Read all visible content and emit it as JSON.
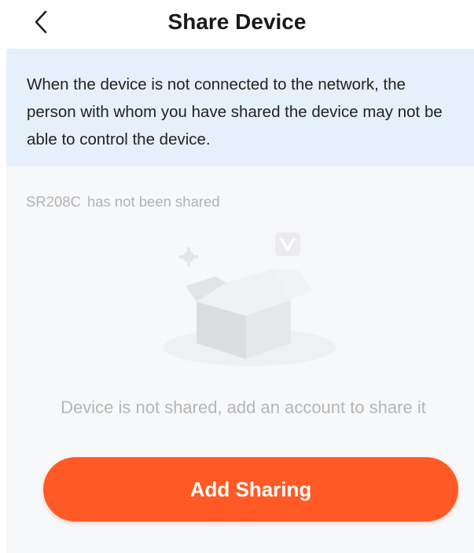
{
  "header": {
    "title": "Share Device",
    "back_icon": "chevron-left-icon"
  },
  "notice": {
    "text": "When the device is not connected to the network, the person with whom you have shared the device may not be able to control the device."
  },
  "share_status": {
    "device_name": "SR208C",
    "status_text": "has not been shared"
  },
  "empty_state": {
    "illustration_icon": "empty-box-icon",
    "message": "Device is not shared, add an account to share it"
  },
  "actions": {
    "add_sharing_label": "Add Sharing"
  },
  "colors": {
    "accent": "#ff5a26",
    "notice_bg": "#e6f0fa",
    "content_bg": "#f7f8fa"
  }
}
